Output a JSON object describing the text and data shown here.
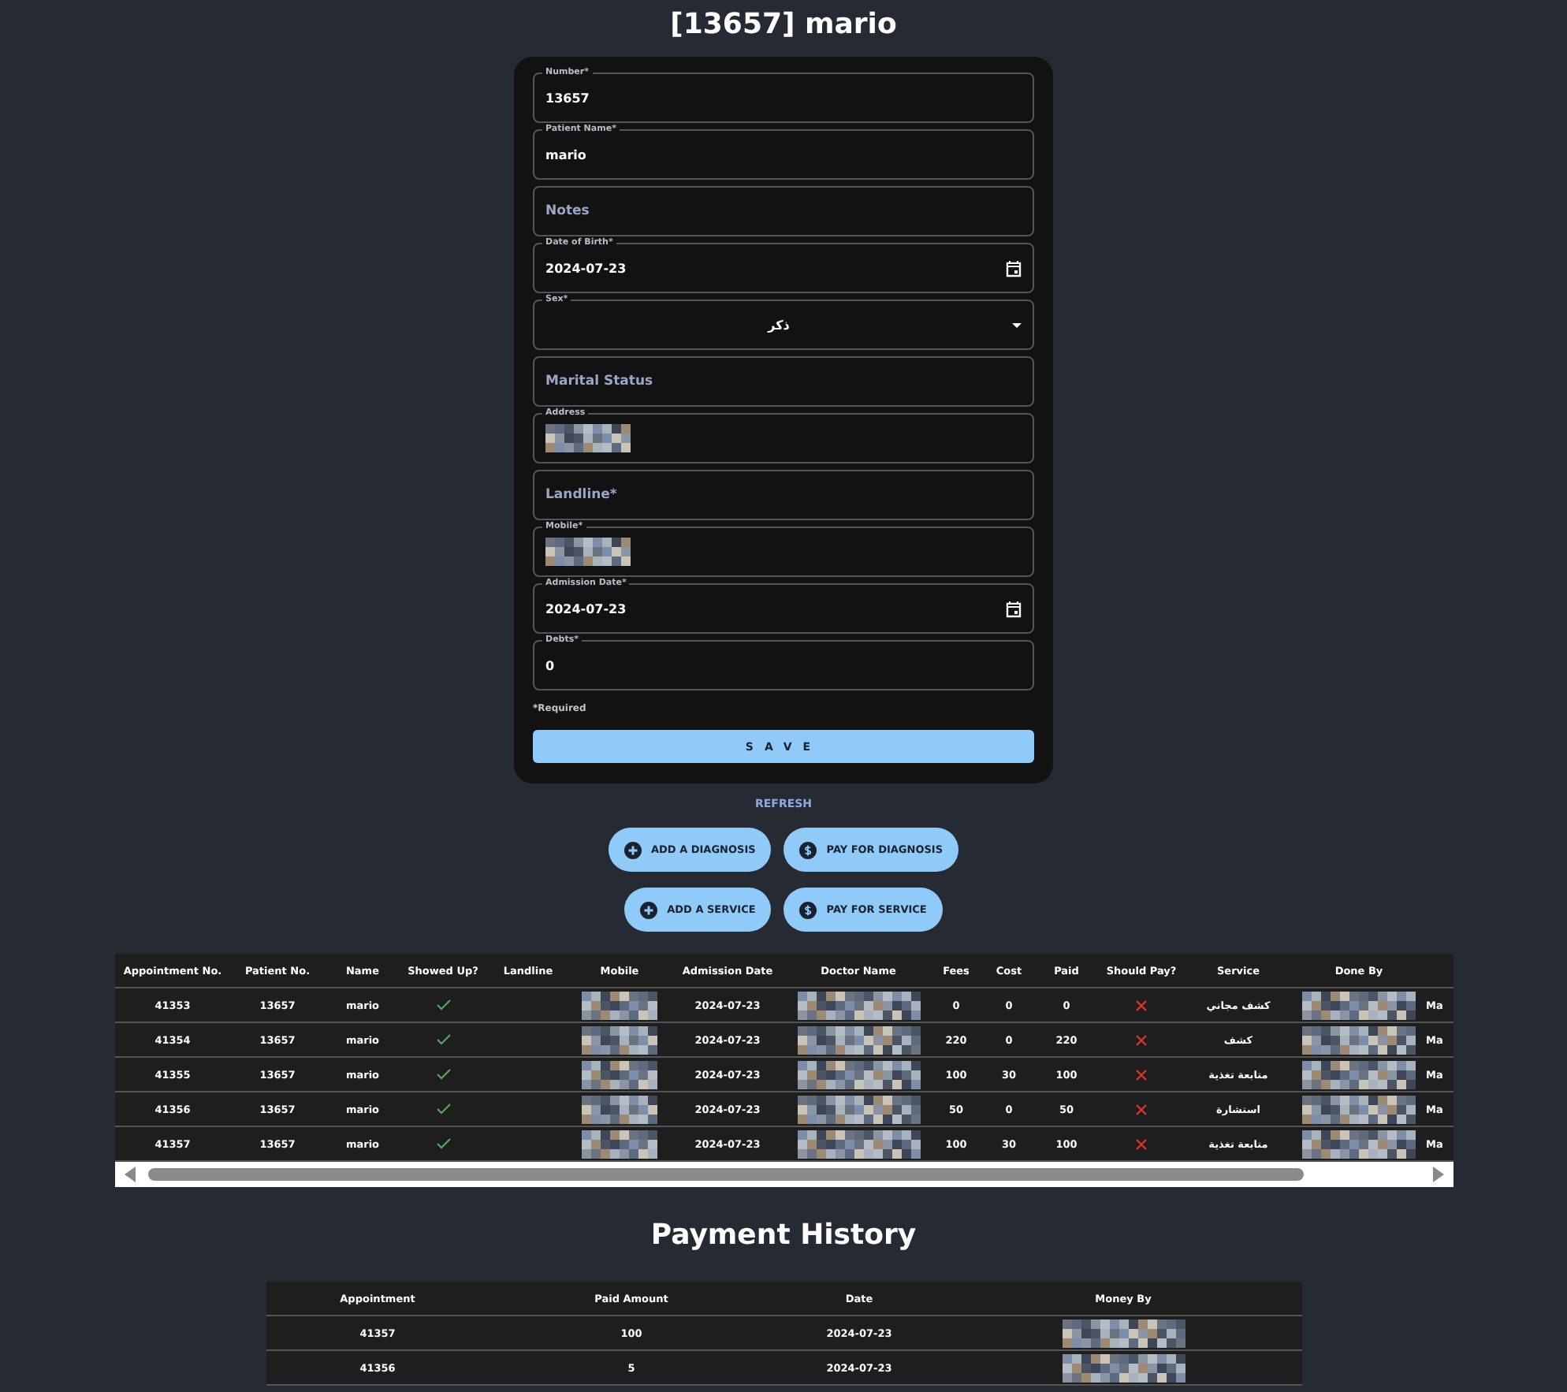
{
  "title": "[13657] mario",
  "form": {
    "fields": [
      {
        "kind": "text",
        "label": "Number*",
        "value": "13657"
      },
      {
        "kind": "text",
        "label": "Patient Name*",
        "value": "mario"
      },
      {
        "kind": "empty",
        "label": "Notes"
      },
      {
        "kind": "date",
        "label": "Date of Birth*",
        "value": "2024-07-23"
      },
      {
        "kind": "select",
        "label": "Sex*",
        "value": "ذكر"
      },
      {
        "kind": "empty",
        "label": "Marital Status"
      },
      {
        "kind": "redacted",
        "label": "Address"
      },
      {
        "kind": "empty",
        "label": "Landline*"
      },
      {
        "kind": "redacted",
        "label": "Mobile*"
      },
      {
        "kind": "date",
        "label": "Admission Date*",
        "value": "2024-07-23"
      },
      {
        "kind": "text",
        "label": "Debts*",
        "value": "0"
      }
    ],
    "required_note": "*Required",
    "save": "SAVE"
  },
  "refresh": "REFRESH",
  "actions": [
    [
      {
        "kind": "add",
        "label": "ADD A DIAGNOSIS"
      },
      {
        "kind": "pay",
        "label": "PAY FOR DIAGNOSIS"
      }
    ],
    [
      {
        "kind": "add",
        "label": "ADD A SERVICE"
      },
      {
        "kind": "pay",
        "label": "PAY FOR SERVICE"
      }
    ]
  ],
  "appointments": {
    "columns": [
      "Appointment No.",
      "Patient No.",
      "Name",
      "Showed Up?",
      "Landline",
      "Mobile",
      "Admission Date",
      "Doctor Name",
      "Fees",
      "Cost",
      "Paid",
      "Should Pay?",
      "Service",
      "Done By"
    ],
    "rows": [
      [
        {
          "kind": "text",
          "text": "41353"
        },
        {
          "kind": "text",
          "text": "13657"
        },
        {
          "kind": "text",
          "text": "mario"
        },
        {
          "kind": "flag",
          "on": true
        },
        {
          "kind": "blank"
        },
        {
          "kind": "redacted"
        },
        {
          "kind": "text",
          "text": "2024-07-23"
        },
        {
          "kind": "redacted"
        },
        {
          "kind": "text",
          "text": "0"
        },
        {
          "kind": "text",
          "text": "0"
        },
        {
          "kind": "text",
          "text": "0"
        },
        {
          "kind": "flag",
          "on": false
        },
        {
          "kind": "text",
          "text": "كشف مجاني"
        },
        {
          "kind": "redacted"
        },
        {
          "kind": "text",
          "text": "Ma"
        }
      ],
      [
        {
          "kind": "text",
          "text": "41354"
        },
        {
          "kind": "text",
          "text": "13657"
        },
        {
          "kind": "text",
          "text": "mario"
        },
        {
          "kind": "flag",
          "on": true
        },
        {
          "kind": "blank"
        },
        {
          "kind": "redacted"
        },
        {
          "kind": "text",
          "text": "2024-07-23"
        },
        {
          "kind": "redacted"
        },
        {
          "kind": "text",
          "text": "220"
        },
        {
          "kind": "text",
          "text": "0"
        },
        {
          "kind": "text",
          "text": "220"
        },
        {
          "kind": "flag",
          "on": false
        },
        {
          "kind": "text",
          "text": "كشف"
        },
        {
          "kind": "redacted"
        },
        {
          "kind": "text",
          "text": "Ma"
        }
      ],
      [
        {
          "kind": "text",
          "text": "41355"
        },
        {
          "kind": "text",
          "text": "13657"
        },
        {
          "kind": "text",
          "text": "mario"
        },
        {
          "kind": "flag",
          "on": true
        },
        {
          "kind": "blank"
        },
        {
          "kind": "redacted"
        },
        {
          "kind": "text",
          "text": "2024-07-23"
        },
        {
          "kind": "redacted"
        },
        {
          "kind": "text",
          "text": "100"
        },
        {
          "kind": "text",
          "text": "30"
        },
        {
          "kind": "text",
          "text": "100"
        },
        {
          "kind": "flag",
          "on": false
        },
        {
          "kind": "text",
          "text": "متابعة تغذية"
        },
        {
          "kind": "redacted"
        },
        {
          "kind": "text",
          "text": "Ma"
        }
      ],
      [
        {
          "kind": "text",
          "text": "41356"
        },
        {
          "kind": "text",
          "text": "13657"
        },
        {
          "kind": "text",
          "text": "mario"
        },
        {
          "kind": "flag",
          "on": true
        },
        {
          "kind": "blank"
        },
        {
          "kind": "redacted"
        },
        {
          "kind": "text",
          "text": "2024-07-23"
        },
        {
          "kind": "redacted"
        },
        {
          "kind": "text",
          "text": "50"
        },
        {
          "kind": "text",
          "text": "0"
        },
        {
          "kind": "text",
          "text": "50"
        },
        {
          "kind": "flag",
          "on": false
        },
        {
          "kind": "text",
          "text": "استشارة"
        },
        {
          "kind": "redacted"
        },
        {
          "kind": "text",
          "text": "Ma"
        }
      ],
      [
        {
          "kind": "text",
          "text": "41357"
        },
        {
          "kind": "text",
          "text": "13657"
        },
        {
          "kind": "text",
          "text": "mario"
        },
        {
          "kind": "flag",
          "on": true
        },
        {
          "kind": "blank"
        },
        {
          "kind": "redacted"
        },
        {
          "kind": "text",
          "text": "2024-07-23"
        },
        {
          "kind": "redacted"
        },
        {
          "kind": "text",
          "text": "100"
        },
        {
          "kind": "text",
          "text": "30"
        },
        {
          "kind": "text",
          "text": "100"
        },
        {
          "kind": "flag",
          "on": false
        },
        {
          "kind": "text",
          "text": "متابعة تغذية"
        },
        {
          "kind": "redacted"
        },
        {
          "kind": "text",
          "text": "Ma"
        }
      ]
    ]
  },
  "payment_history": {
    "title": "Payment History",
    "columns": [
      "Appointment",
      "Paid Amount",
      "Date",
      "Money By"
    ],
    "rows": [
      [
        {
          "kind": "text",
          "text": "41357"
        },
        {
          "kind": "text",
          "text": "100"
        },
        {
          "kind": "text",
          "text": "2024-07-23"
        },
        {
          "kind": "redacted"
        }
      ],
      [
        {
          "kind": "text",
          "text": "41356"
        },
        {
          "kind": "text",
          "text": "5"
        },
        {
          "kind": "text",
          "text": "2024-07-23"
        },
        {
          "kind": "redacted"
        }
      ]
    ]
  }
}
